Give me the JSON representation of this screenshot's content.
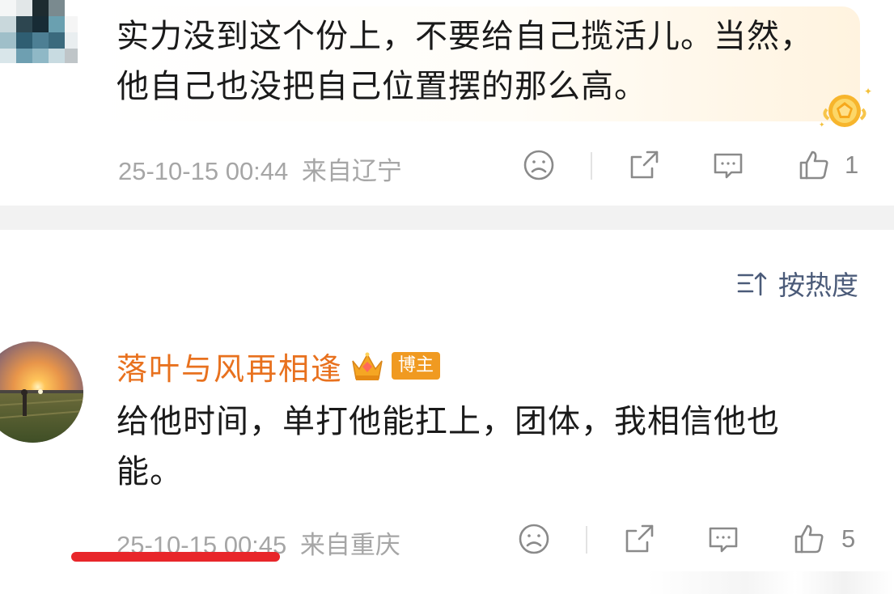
{
  "comment_1": {
    "text": "实力没到这个份上，不要给自己揽活儿。当然，他自己也没把自己位置摆的那么高。",
    "timestamp": "25-10-15 00:44",
    "location": "来自辽宁",
    "like_count": "1",
    "icons": [
      "sad-face-icon",
      "share-icon",
      "comment-icon",
      "thumbs-up-icon"
    ]
  },
  "sort": {
    "label": "按热度",
    "icon": "sort-icon"
  },
  "comment_2": {
    "username": "落叶与风再相逢",
    "author_tag": "博主",
    "text": "给他时间，单打他能扛上，团体，我相信他也能。",
    "timestamp": "25-10-15 00:45",
    "location": "来自重庆",
    "like_count": "5",
    "icons": [
      "sad-face-icon",
      "share-icon",
      "comment-icon",
      "thumbs-up-icon"
    ]
  },
  "colors": {
    "username": "#e8711e",
    "author_tag_bg": "#f09a21",
    "meta_text": "#a6a6a6",
    "sort_text": "#4b5b79",
    "underline": "#e8262a"
  }
}
